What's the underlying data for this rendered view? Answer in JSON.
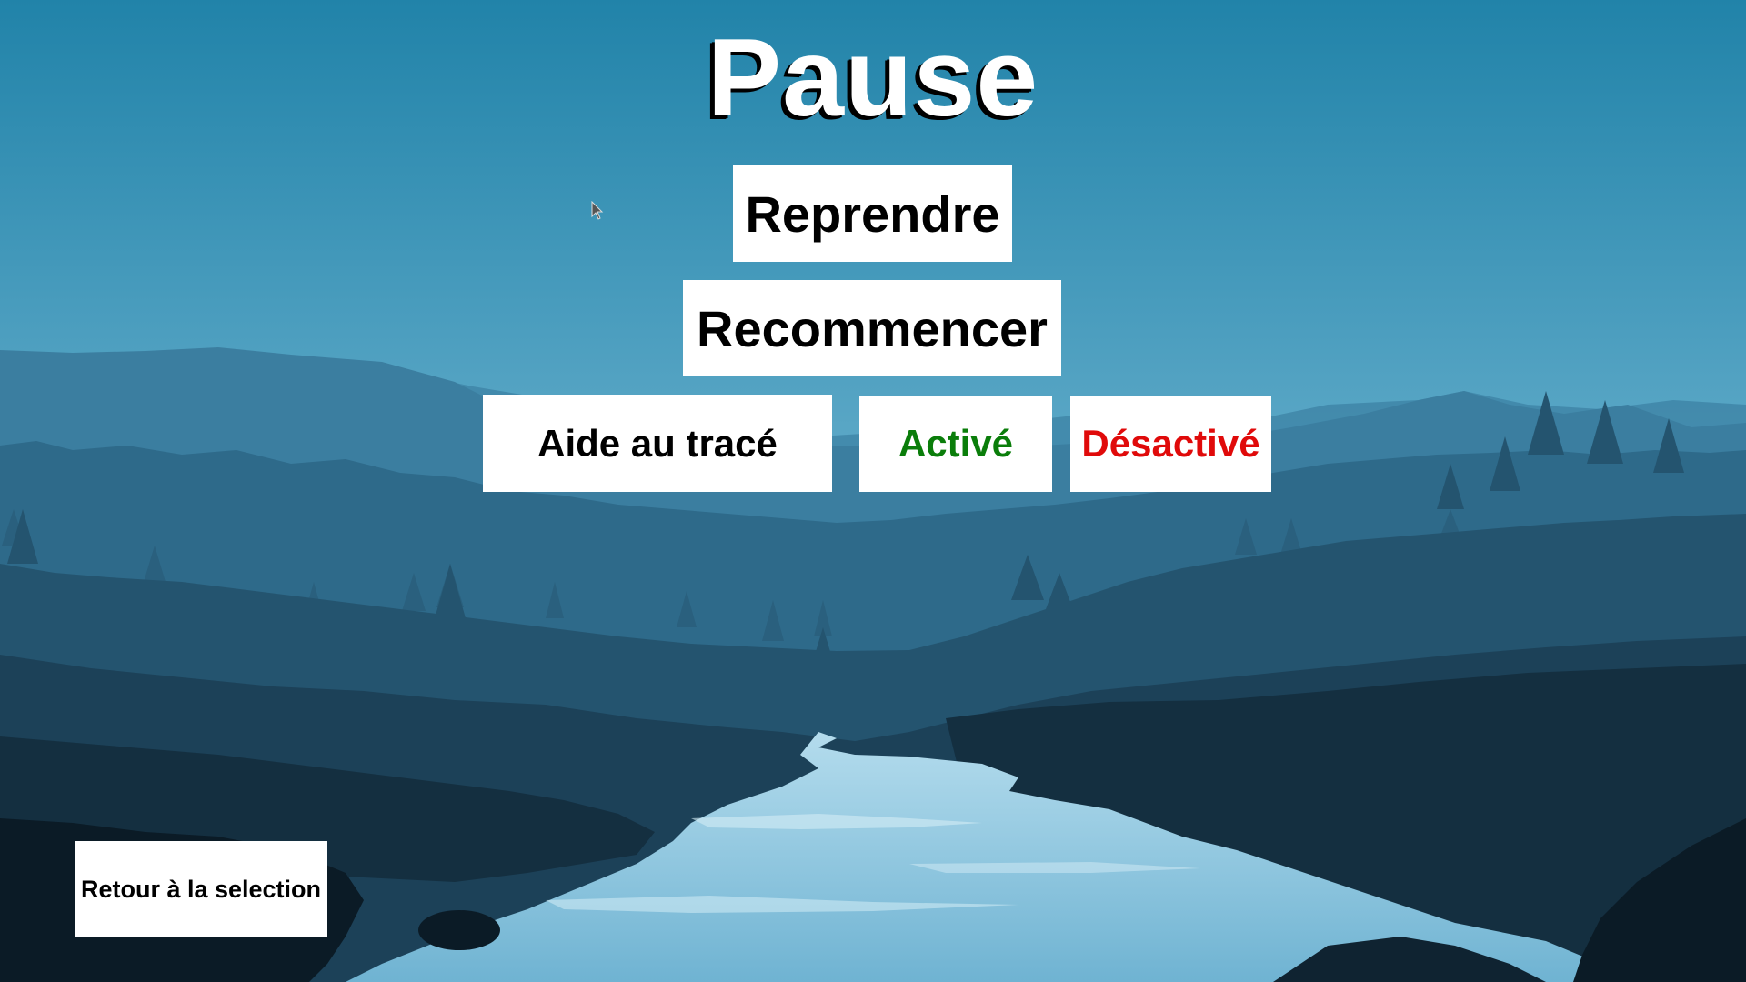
{
  "menu": {
    "title": "Pause",
    "resume_label": "Reprendre",
    "restart_label": "Recommencer",
    "back_label": "Retour à la selection"
  },
  "drawing_aid": {
    "label": "Aide au tracé",
    "enabled_label": "Activé",
    "disabled_label": "Désactivé",
    "enabled_color": "#0a7d0a",
    "disabled_color": "#e00a0a"
  },
  "colors": {
    "sky_top": "#2484aa",
    "sky_bottom": "#5fa9c8",
    "button_bg": "#ffffff",
    "title_color": "#ffffff"
  },
  "icons": {
    "cursor": "mouse-pointer-icon"
  }
}
